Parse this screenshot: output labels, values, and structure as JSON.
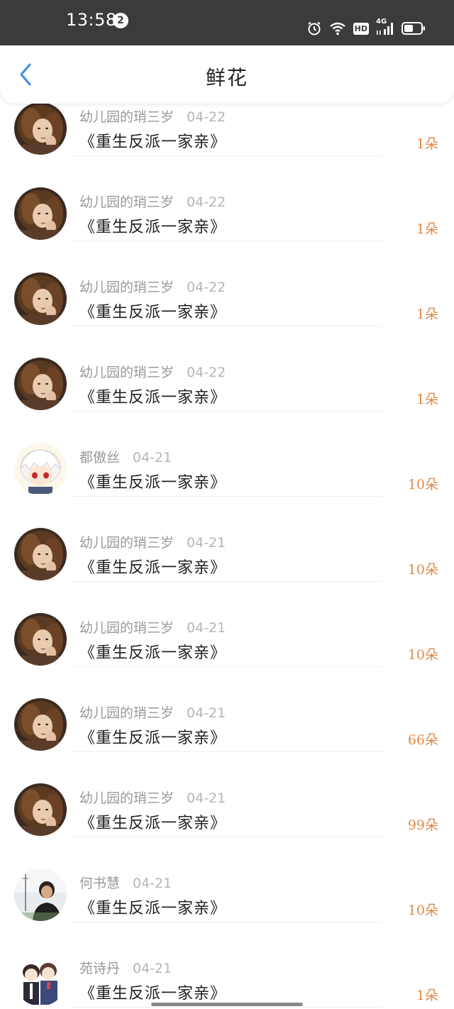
{
  "status_bar": {
    "time": "13:58",
    "notification_count": "2",
    "hd_label": "HD",
    "network_label": "4G"
  },
  "nav": {
    "title": "鲜花",
    "back_icon": "chevron-left-icon",
    "accent_color": "#3a8ee6"
  },
  "items": [
    {
      "user": "幼儿园的琑三岁",
      "date": "04-22",
      "book": "《重生反派一家亲》",
      "amount": "1朵",
      "avatar": "woman-brown-hair"
    },
    {
      "user": "幼儿园的琑三岁",
      "date": "04-22",
      "book": "《重生反派一家亲》",
      "amount": "1朵",
      "avatar": "woman-brown-hair"
    },
    {
      "user": "幼儿园的琑三岁",
      "date": "04-22",
      "book": "《重生反派一家亲》",
      "amount": "1朵",
      "avatar": "woman-brown-hair"
    },
    {
      "user": "幼儿园的琑三岁",
      "date": "04-22",
      "book": "《重生反派一家亲》",
      "amount": "1朵",
      "avatar": "woman-brown-hair"
    },
    {
      "user": "都傲丝",
      "date": "04-21",
      "book": "《重生反派一家亲》",
      "amount": "10朵",
      "avatar": "anime-white-hair"
    },
    {
      "user": "幼儿园的琑三岁",
      "date": "04-21",
      "book": "《重生反派一家亲》",
      "amount": "10朵",
      "avatar": "woman-brown-hair"
    },
    {
      "user": "幼儿园的琑三岁",
      "date": "04-21",
      "book": "《重生反派一家亲》",
      "amount": "10朵",
      "avatar": "woman-brown-hair"
    },
    {
      "user": "幼儿园的琑三岁",
      "date": "04-21",
      "book": "《重生反派一家亲》",
      "amount": "66朵",
      "avatar": "woman-brown-hair"
    },
    {
      "user": "幼儿园的琑三岁",
      "date": "04-21",
      "book": "《重生反派一家亲》",
      "amount": "99朵",
      "avatar": "woman-brown-hair"
    },
    {
      "user": "何书慧",
      "date": "04-21",
      "book": "《重生反派一家亲》",
      "amount": "10朵",
      "avatar": "woman-photo"
    },
    {
      "user": "苑诗丹",
      "date": "04-21",
      "book": "《重生反派一家亲》",
      "amount": "1朵",
      "avatar": "anime-couple"
    }
  ],
  "colors": {
    "amount": "#e08a4a",
    "status_bar_bg": "#3b3b3b"
  }
}
